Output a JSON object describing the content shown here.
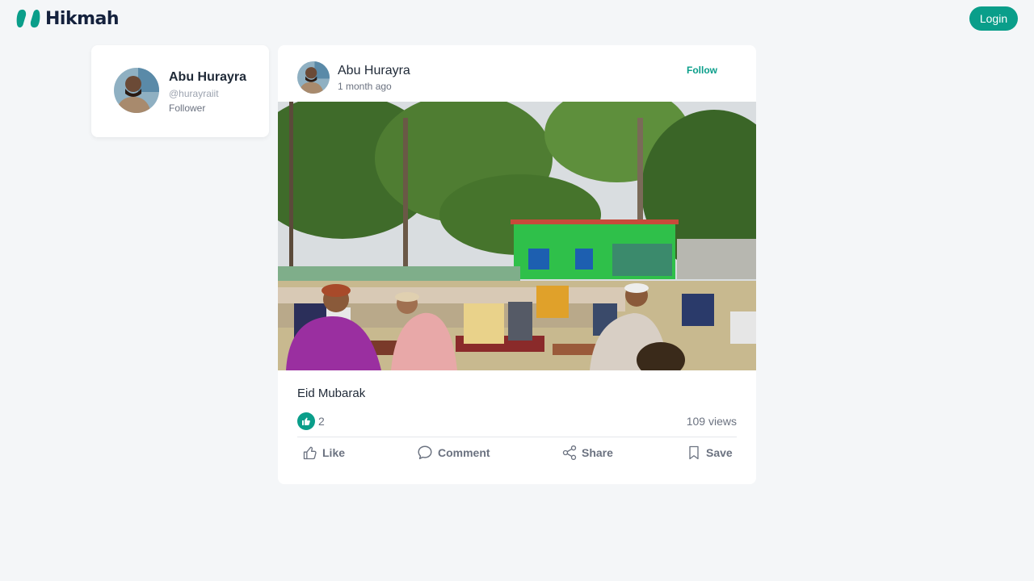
{
  "header": {
    "brand_name": "Hikmah",
    "login_label": "Login",
    "accent_color": "#0a9e8a"
  },
  "profile": {
    "name": "Abu Hurayra",
    "handle": "@hurayraiit",
    "role": "Follower",
    "avatar_icon": "user-avatar"
  },
  "post": {
    "author": "Abu Hurayra",
    "time": "1 month ago",
    "follow_label": "Follow",
    "caption": "Eid Mubarak",
    "likes": "2",
    "views": "109 views",
    "image_subject": "eid-prayer-photo"
  },
  "actions": {
    "like": "Like",
    "comment": "Comment",
    "share": "Share",
    "save": "Save"
  },
  "icons": [
    "brand-logo-icon",
    "thumbs-up-icon",
    "like-icon",
    "comment-icon",
    "share-icon",
    "bookmark-icon"
  ]
}
